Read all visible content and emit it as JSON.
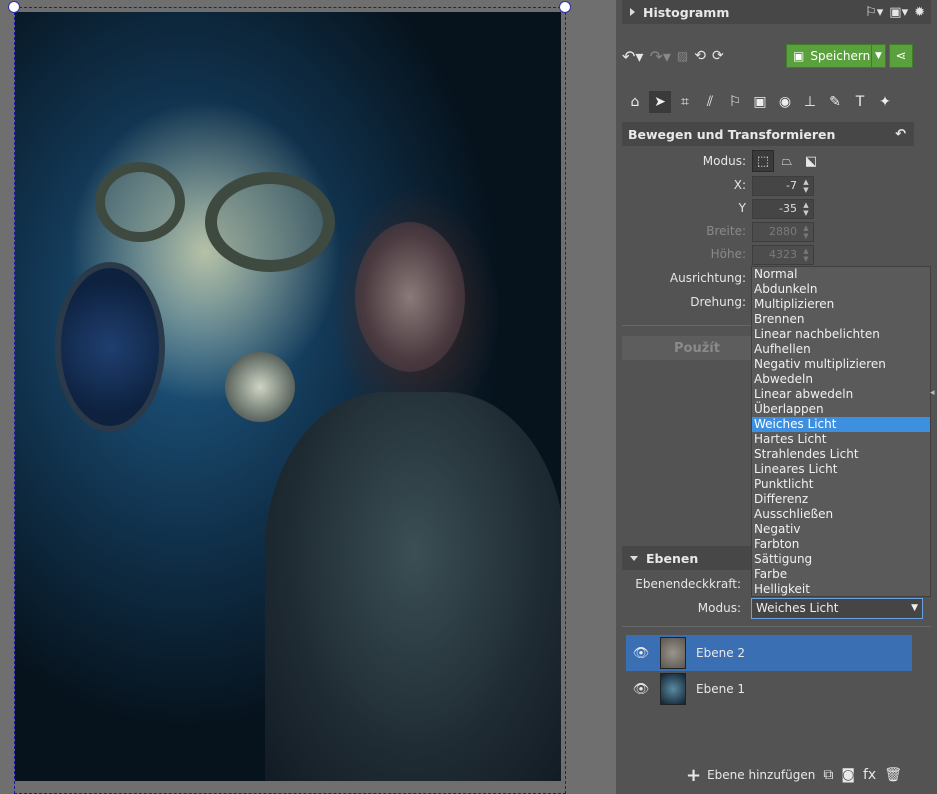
{
  "histogram": {
    "title": "Histogramm"
  },
  "toolbar": {
    "save_label": "Speichern"
  },
  "transform": {
    "title": "Bewegen und Transformieren",
    "modus_label": "Modus:",
    "x_label": "X:",
    "x_value": "-7",
    "y_label": "Y",
    "y_value": "-35",
    "breite_label": "Breite:",
    "breite_value": "2880",
    "hoehe_label": "Höhe:",
    "hoehe_value": "4323",
    "ausrichtung_label": "Ausrichtung:",
    "drehung_label": "Drehung:",
    "apply_label": "Použít"
  },
  "blend_modes": [
    "Normal",
    "Abdunkeln",
    "Multiplizieren",
    "Brennen",
    "Linear nachbelichten",
    "Aufhellen",
    "Negativ multiplizieren",
    "Abwedeln",
    "Linear abwedeln",
    "Überlappen",
    "Weiches Licht",
    "Hartes Licht",
    "Strahlendes Licht",
    "Lineares Licht",
    "Punktlicht",
    "Differenz",
    "Ausschließen",
    "Negativ",
    "Farbton",
    "Sättigung",
    "Farbe",
    "Helligkeit"
  ],
  "selected_blend_mode": "Weiches Licht",
  "layers_panel": {
    "title": "Ebenen",
    "opacity_label": "Ebenendeckkraft:",
    "mode_label": "Modus:",
    "layers": [
      {
        "name": "Ebene 2",
        "active": true
      },
      {
        "name": "Ebene 1",
        "active": false
      }
    ],
    "add_layer_label": "Ebene hinzufügen",
    "fx_label": "fx"
  },
  "colors": {
    "accent_green": "#5aa03c",
    "selection_blue": "#3d8fe0",
    "active_layer": "#3a6fb4"
  }
}
